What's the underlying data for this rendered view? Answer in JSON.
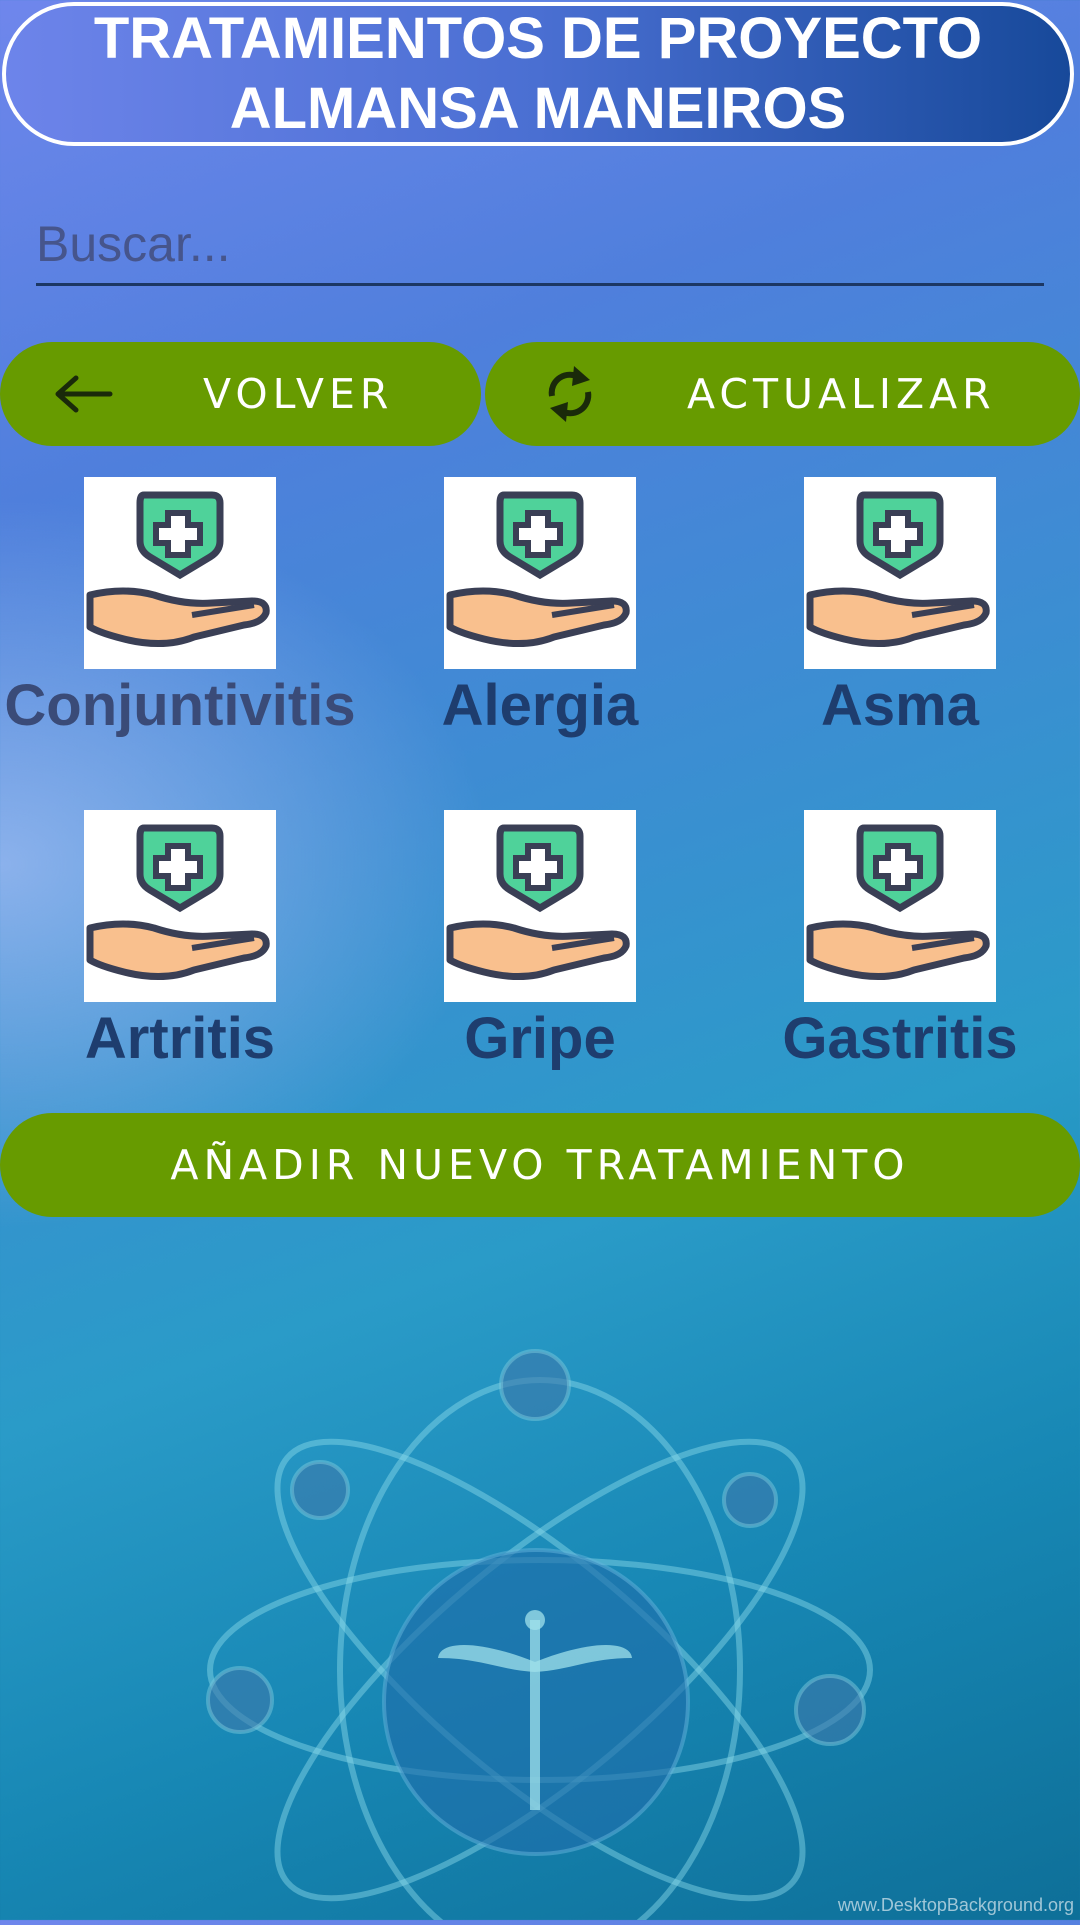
{
  "header": {
    "title_line1": "TRATAMIENTOS DE PROYECTO",
    "title_line2": "ALMANSA MANEIROS"
  },
  "search": {
    "placeholder": "Buscar...",
    "value": ""
  },
  "buttons": {
    "back_label": "VOLVER",
    "back_icon": "arrow-left-icon",
    "refresh_label": "ACTUALIZAR",
    "refresh_icon": "refresh-icon",
    "add_label": "AÑADIR NUEVO TRATAMIENTO",
    "color": "#679b00"
  },
  "treatments": [
    {
      "name": "Conjuntivitis",
      "icon": "treatment-hand-shield-icon"
    },
    {
      "name": "Alergia",
      "icon": "treatment-hand-shield-icon"
    },
    {
      "name": "Asma",
      "icon": "treatment-hand-shield-icon"
    },
    {
      "name": "Artritis",
      "icon": "treatment-hand-shield-icon"
    },
    {
      "name": "Gripe",
      "icon": "treatment-hand-shield-icon"
    },
    {
      "name": "Gastritis",
      "icon": "treatment-hand-shield-icon"
    }
  ],
  "background": {
    "watermark": "www.DesktopBackground.org"
  }
}
